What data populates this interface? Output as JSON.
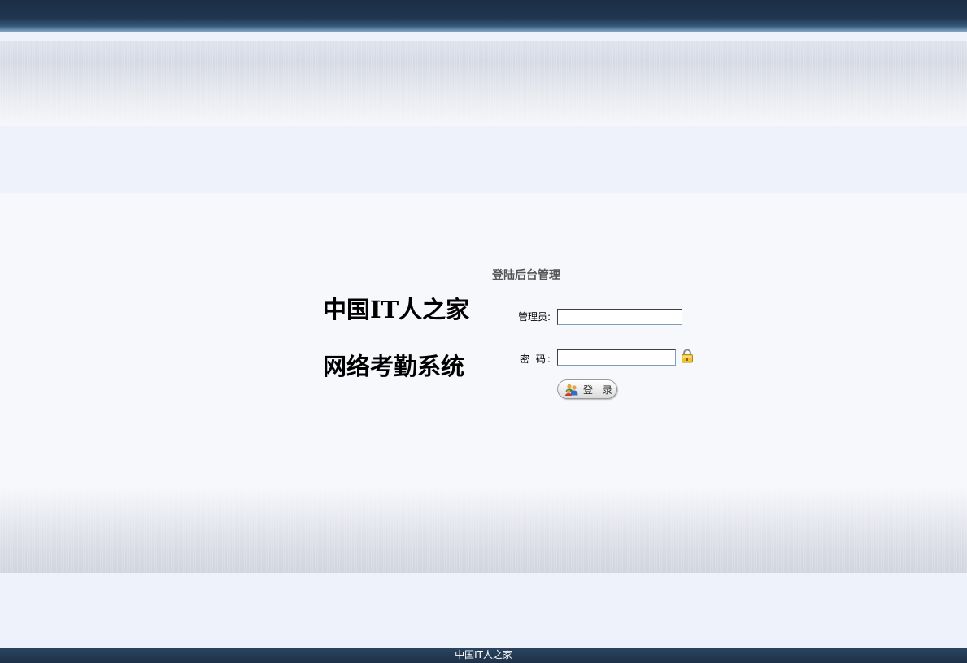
{
  "brand": {
    "line1": "中国IT人之家",
    "line2": "网络考勤系统"
  },
  "login": {
    "title": "登陆后台管理",
    "admin_label": "管理员:",
    "admin_value": "",
    "password_label": "密 码:",
    "password_value": "",
    "submit_label": "登 录"
  },
  "footer": {
    "text": "中国IT人之家"
  },
  "icons": {
    "lock": "lock-icon",
    "login_button": "users-icon"
  },
  "colors": {
    "top_bar": "#1b2e45",
    "background": "#eef2fa",
    "title_text": "#555555"
  }
}
